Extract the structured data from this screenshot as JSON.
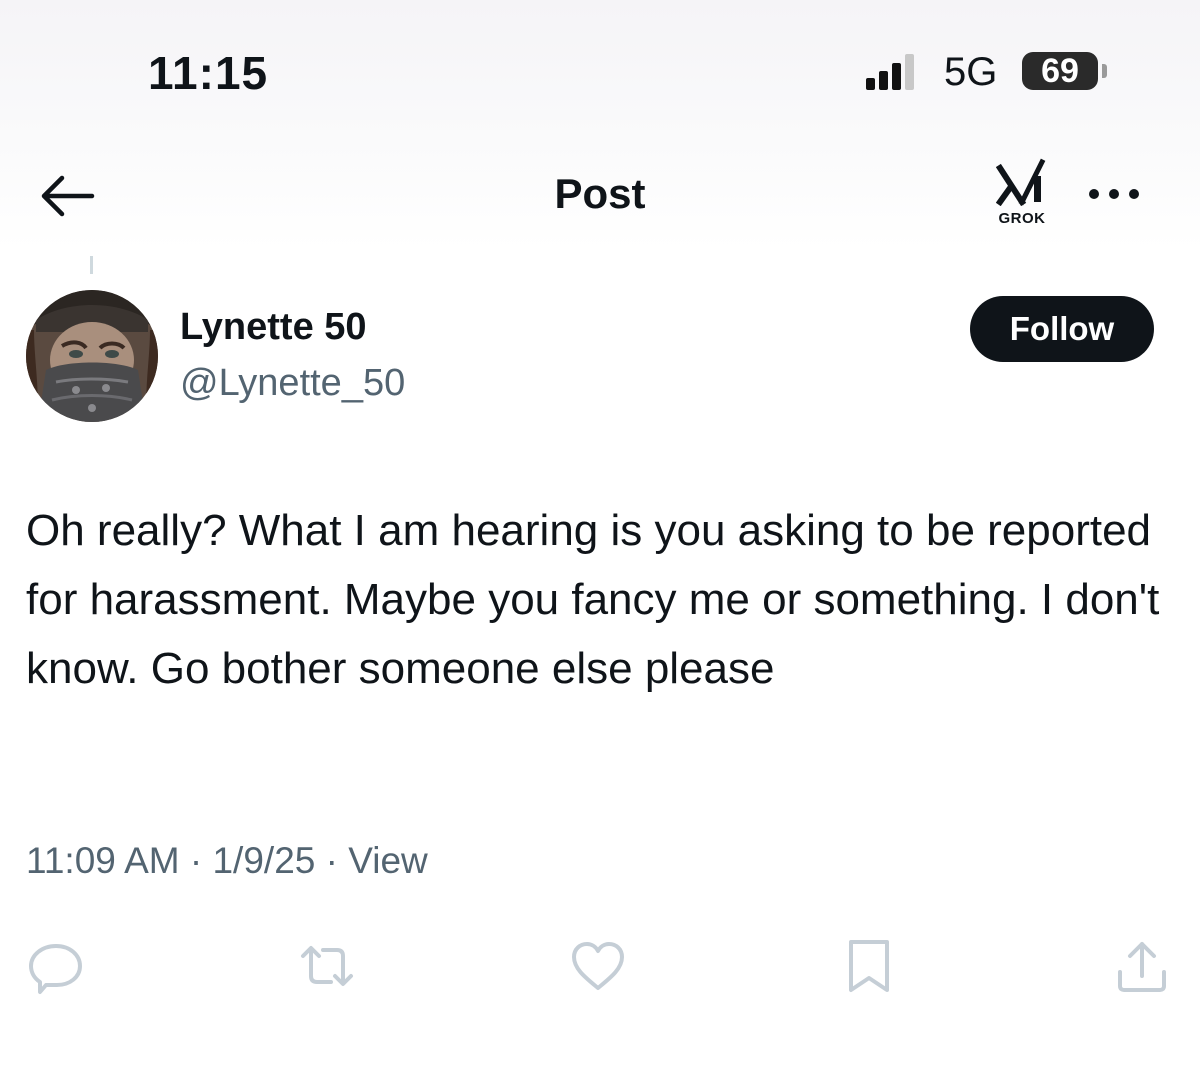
{
  "status_bar": {
    "time": "11:15",
    "network": "5G",
    "battery": "69",
    "signal_icon": "cellular-signal-icon"
  },
  "nav": {
    "title": "Post",
    "back_icon": "arrow-left-icon",
    "grok_label": "GROK",
    "more_icon": "more-horizontal-icon"
  },
  "author": {
    "display_name": "Lynette 50",
    "handle": "@Lynette_50",
    "follow_label": "Follow"
  },
  "post": {
    "text": "Oh really? What I am hearing is you asking to be reported for harassment. Maybe you fancy me or something. I don't know. Go bother someone else please",
    "time": "11:09 AM",
    "date": "1/9/25",
    "view_label": "View"
  },
  "actions": [
    "reply-icon",
    "repost-icon",
    "like-icon",
    "bookmark-icon",
    "share-icon"
  ],
  "colors": {
    "text": "#0f1419",
    "secondary": "#536471",
    "icon": "#c5ced6",
    "follow_bg": "#0f1419"
  }
}
